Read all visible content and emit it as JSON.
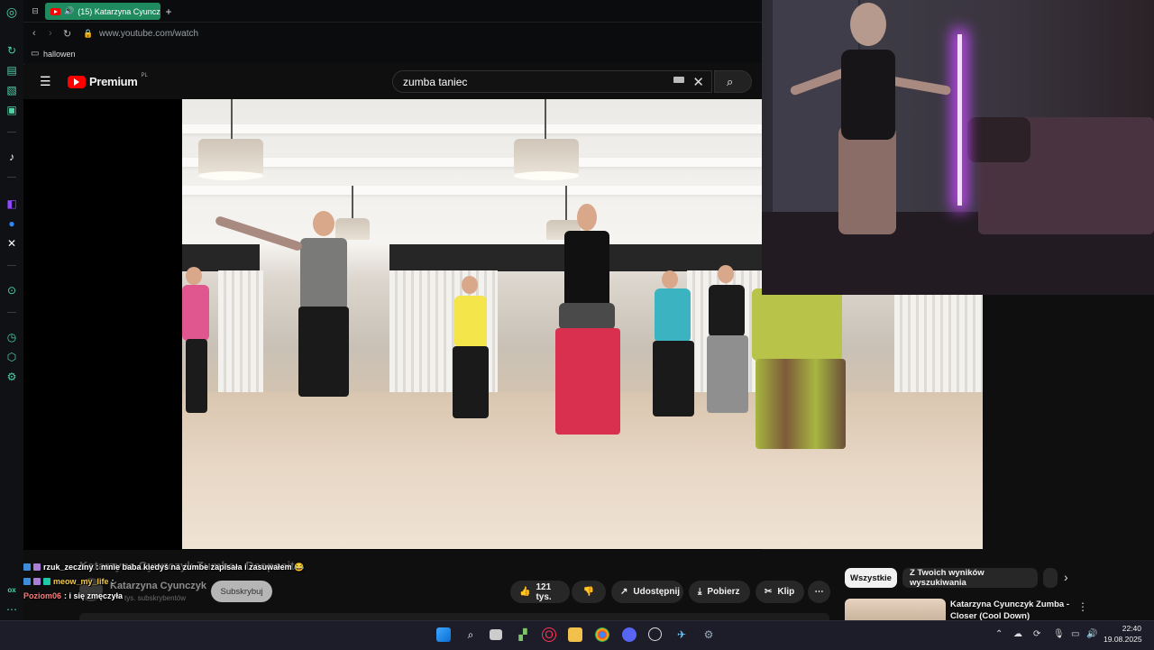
{
  "browser": {
    "tab": {
      "title": "(15) Katarzyna Cyuncz",
      "new_tab": "+"
    },
    "address": "www.youtube.com/watch",
    "bookmark": "hallowen"
  },
  "youtube": {
    "logo_text": "Premium",
    "logo_region": "PL",
    "search_query": "zumba taniec",
    "video_title": "Katarzyna Cyunczyk Zumba - Despacito",
    "channel_name": "Katarzyna Cyunczyk",
    "subscribers": "tys. subskrybentów",
    "subscribe_label": "Subskrybuj",
    "likes": "121 tys.",
    "share_label": "Udostępnij",
    "download_label": "Pobierz",
    "clip_label": "Klip",
    "more_label": "⋯",
    "filter_chips": [
      "Wszystkie",
      "Z Twoich wyników wyszukiwania"
    ],
    "rec_title_1": "Katarzyna Cyunczyk Zumba -",
    "rec_title_2": "Closer (Cool Down)"
  },
  "chat": [
    {
      "user": "rzuk_zecziny",
      "user_color": "#ffffff",
      "message": ": mnie baba kiedyś na zumbe zapisała i zasuwałem 😂"
    },
    {
      "user": "meow_my_life",
      "user_color": "#f2c94c",
      "message": ":"
    },
    {
      "user": "Poziom06",
      "user_color": "#ff7a7a",
      "message": ": i się zmęczyła"
    }
  ],
  "sidebar_label": "ox",
  "taskbar": {
    "time": "22:40",
    "date": "19.08.2025"
  },
  "colors": {
    "accent": "#1e8a5e",
    "youtube_red": "#ff0000",
    "sidebar_icon": "#4ed3a6"
  }
}
